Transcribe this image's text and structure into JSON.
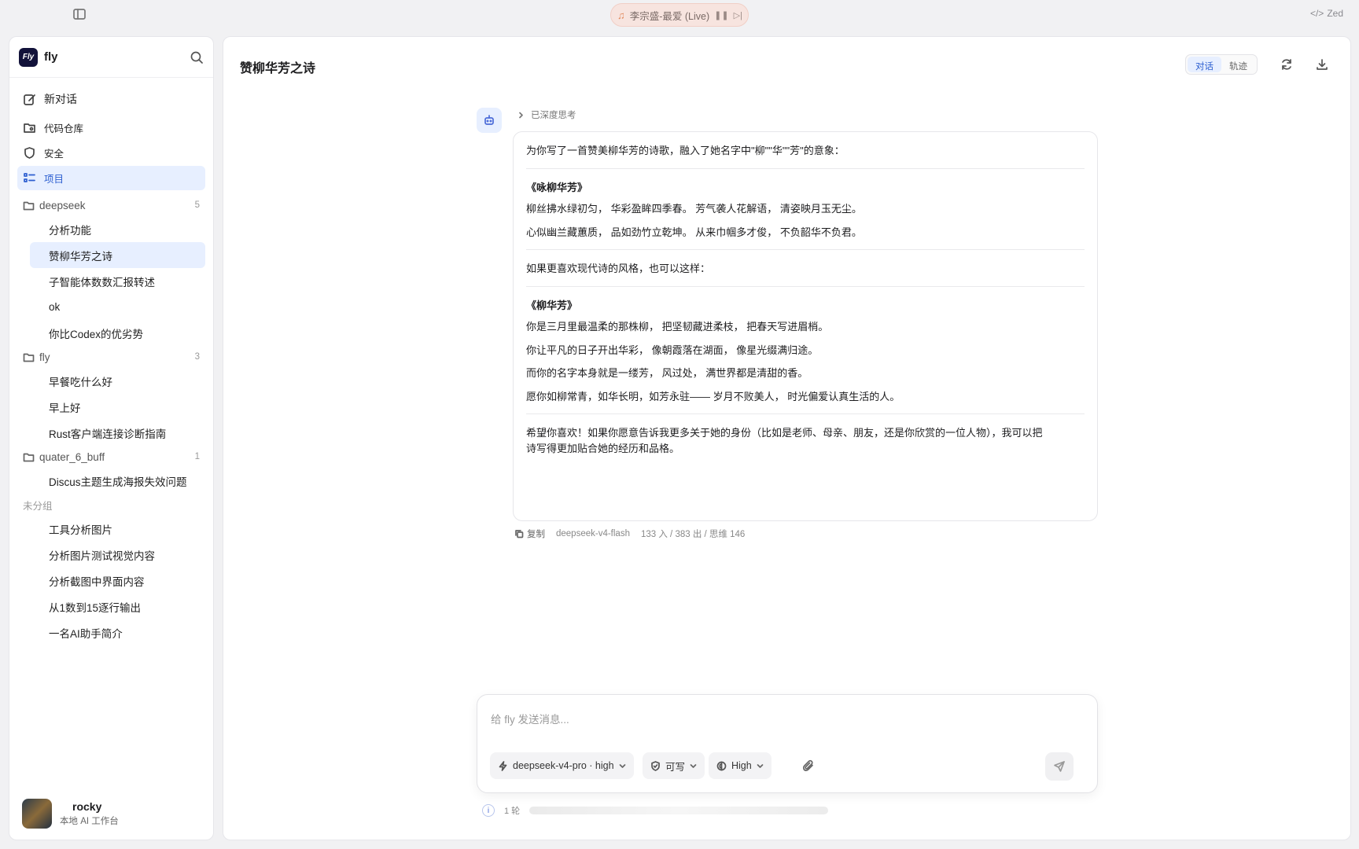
{
  "topbar": {
    "media": "李宗盛-最爱 (Live)",
    "app_label": "Zed"
  },
  "sidebar": {
    "title": "fly",
    "logo_text": "Fly",
    "nav": [
      {
        "label": "新对话",
        "icon": "edit-icon"
      },
      {
        "label": "代码仓库",
        "icon": "repo-icon"
      },
      {
        "label": "安全",
        "icon": "shield-icon"
      },
      {
        "label": "项目",
        "icon": "list-icon"
      }
    ],
    "groups": [
      {
        "name": "deepseek",
        "count": "5",
        "items": [
          "分析功能",
          "赞柳华芳之诗",
          "子智能体数数汇报转述",
          "ok",
          "你比Codex的优劣势"
        ]
      },
      {
        "name": "fly",
        "count": "3",
        "items": [
          "早餐吃什么好",
          "早上好",
          "Rust客户端连接诊断指南"
        ]
      },
      {
        "name": "quater_6_buff",
        "count": "1",
        "items": [
          "Discus主题生成海报失效问题"
        ]
      }
    ],
    "ungrouped_label": "未分组",
    "ungrouped": [
      "工具分析图片",
      "分析图片测试视觉内容",
      "分析截图中界面内容",
      "从1数到15逐行输出",
      "一名AI助手简介"
    ],
    "user": {
      "name": "rocky",
      "subtitle": "本地 AI 工作台"
    }
  },
  "main": {
    "title": "赞柳华芳之诗",
    "view_tabs": [
      "对话",
      "轨迹"
    ],
    "thinking_label": "已深度思考",
    "message": {
      "intro": "为你写了一首赞美柳华芳的诗歌，融入了她名字中\"柳\"\"华\"\"芳\"的意象：",
      "poem1_title": "《咏柳华芳》",
      "poem1_lines": [
        "柳丝拂水绿初匀， 华彩盈眸四季春。 芳气袭人花解语， 清姿映月玉无尘。",
        "心似幽兰藏蕙质， 品如劲竹立乾坤。 从来巾帼多才俊， 不负韶华不负君。"
      ],
      "transition": "如果更喜欢现代诗的风格，也可以这样：",
      "poem2_title": "《柳华芳》",
      "poem2_lines": [
        "你是三月里最温柔的那株柳， 把坚韧藏进柔枝， 把春天写进眉梢。",
        "你让平凡的日子开出华彩， 像朝霞落在湖面， 像星光缀满归途。",
        "而你的名字本身就是一缕芳， 风过处， 满世界都是清甜的香。",
        "愿你如柳常青，如华长明，如芳永驻—— 岁月不败美人， 时光偏爱认真生活的人。"
      ],
      "closing1": "希望你喜欢！如果你愿意告诉我更多关于她的身份（比如是老师、母亲、朋友，还是你欣赏的一位人物），我可以把",
      "closing2": "诗写得更加贴合她的经历和品格。"
    },
    "meta": {
      "copy_label": "复制",
      "model": "deepseek-v4-flash",
      "tokens": "133 入 / 383 出 / 思维 146"
    },
    "composer": {
      "placeholder": "给 fly 发送消息...",
      "model_chip": "deepseek-v4-pro · high",
      "perm_chip": "可写",
      "effort_chip": "High"
    },
    "footer_info": "1 轮"
  }
}
